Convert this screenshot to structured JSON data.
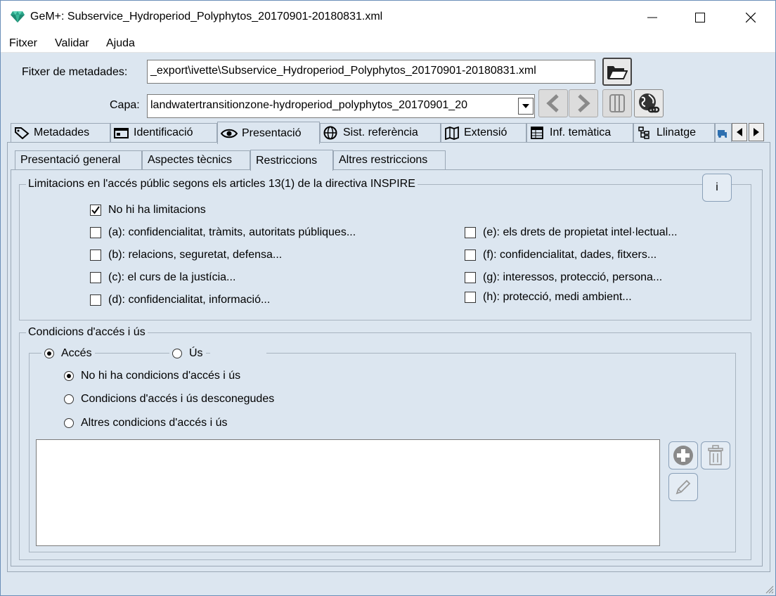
{
  "window": {
    "title": "GeM+: Subservice_Hydroperiod_Polyphytos_20170901-20180831.xml"
  },
  "menu": [
    "Fitxer",
    "Validar",
    "Ajuda"
  ],
  "metadata_file": {
    "label": "Fitxer de metadades:",
    "value": "_export\\ivette\\Subservice_Hydroperiod_Polyphytos_20170901-20180831.xml"
  },
  "layer": {
    "label": "Capa:",
    "value": "landwatertransitionzone-hydroperiod_polyphytos_20170901_20"
  },
  "tabs": [
    "Metadades",
    "Identificació",
    "Presentació",
    "Sist. referència",
    "Extensió",
    "Inf. temàtica",
    "Llinatge"
  ],
  "subtabs": [
    "Presentació general",
    "Aspectes tècnics",
    "Restriccions",
    "Altres restriccions"
  ],
  "limitations": {
    "title": "Limitacions en l'accés públic segons els articles 13(1) de la directiva INSPIRE",
    "info_label": "i",
    "none_label": "No hi ha limitacions",
    "left": [
      "(a): confidencialitat, tràmits, autoritats públiques...",
      "(b): relacions, seguretat, defensa...",
      "(c): el curs de la justícia...",
      "(d): confidencialitat, informació..."
    ],
    "right": [
      "(e): els drets de propietat intel·lectual...",
      "(f): confidencialitat, dades, fitxers...",
      "(g): interessos, protecció, persona...",
      "(h): protecció, medi ambient..."
    ]
  },
  "conditions": {
    "title": "Condicions d'accés i ús",
    "access_label": "Accés",
    "use_label": "Ús",
    "options": [
      "No hi ha condicions d'accés i ús",
      "Condicions d'accés i ús desconegudes",
      "Altres condicions d'accés i ús"
    ]
  }
}
